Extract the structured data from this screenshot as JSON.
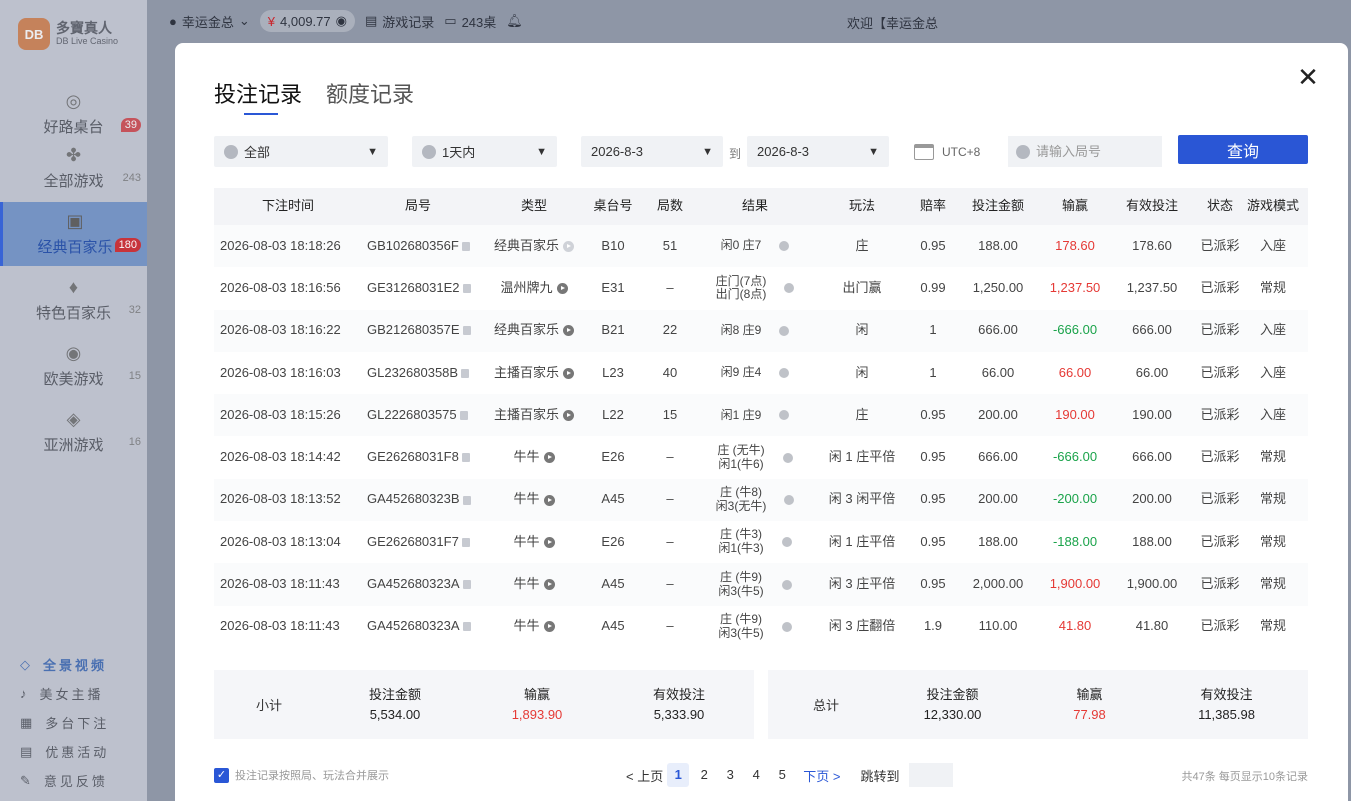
{
  "sidebar": {
    "logo_text": "多寶真人",
    "logo_sub": "DB Live Casino",
    "logo_box": "DB",
    "items": [
      {
        "label": "好路桌台",
        "count": "39",
        "icon": "roulette-icon"
      },
      {
        "label": "全部游戏",
        "count": "243",
        "icon": "clover-icon"
      },
      {
        "label": "经典百家乐",
        "count": "180",
        "icon": "cards-icon"
      },
      {
        "label": "特色百家乐",
        "count": "32",
        "icon": "card-icon"
      },
      {
        "label": "欧美游戏",
        "count": "15",
        "icon": "chip-icon"
      },
      {
        "label": "亚洲游戏",
        "count": "16",
        "icon": "dice-icon"
      }
    ],
    "bottom_links": [
      "全景视频",
      "美女主播",
      "多台下注",
      "优惠活动",
      "意见反馈"
    ]
  },
  "topbar": {
    "user": "幸运金总",
    "balance": "4,009.77",
    "records": "游戏记录",
    "tables": "243桌",
    "welcome": "欢迎【幸运金总"
  },
  "modal": {
    "tabs": [
      "投注记录",
      "额度记录"
    ],
    "filters": {
      "game": "全部",
      "period": "1天内",
      "date_from": "2026-8-3",
      "to_label": "到",
      "date_to": "2026-8-3",
      "timezone": "UTC+8",
      "search_placeholder": "请输入局号",
      "query_button": "查询"
    },
    "columns": [
      "下注时间",
      "局号",
      "类型",
      "桌台号",
      "局数",
      "结果",
      "玩法",
      "赔率",
      "投注金额",
      "输赢",
      "有效投注",
      "状态",
      "游戏模式"
    ],
    "rows": [
      {
        "time": "2026-08-03 18:18:26",
        "id": "GB102680356F",
        "type": "经典百家乐",
        "table": "B10",
        "round": "51",
        "result": "闲0 庄7",
        "play": "庄",
        "odds": "0.95",
        "bet": "188.00",
        "winloss": "178.60",
        "wl_status": "win",
        "valid": "178.60",
        "status": "已派彩",
        "mode": "入座"
      },
      {
        "time": "2026-08-03 18:16:56",
        "id": "GE31268031E2",
        "type": "温州牌九",
        "table": "E31",
        "round": "–",
        "result": "庄门(7点)\n出门(8点)",
        "play": "出门赢",
        "odds": "0.99",
        "bet": "1,250.00",
        "winloss": "1,237.50",
        "wl_status": "win",
        "valid": "1,237.50",
        "status": "已派彩",
        "mode": "常规"
      },
      {
        "time": "2026-08-03 18:16:22",
        "id": "GB212680357E",
        "type": "经典百家乐",
        "table": "B21",
        "round": "22",
        "result": "闲8 庄9",
        "play": "闲",
        "odds": "1",
        "bet": "666.00",
        "winloss": "-666.00",
        "wl_status": "lose",
        "valid": "666.00",
        "status": "已派彩",
        "mode": "入座"
      },
      {
        "time": "2026-08-03 18:16:03",
        "id": "GL232680358B",
        "type": "主播百家乐",
        "table": "L23",
        "round": "40",
        "result": "闲9 庄4",
        "play": "闲",
        "odds": "1",
        "bet": "66.00",
        "winloss": "66.00",
        "wl_status": "win",
        "valid": "66.00",
        "status": "已派彩",
        "mode": "入座"
      },
      {
        "time": "2026-08-03 18:15:26",
        "id": "GL2226803575",
        "type": "主播百家乐",
        "table": "L22",
        "round": "15",
        "result": "闲1 庄9",
        "play": "庄",
        "odds": "0.95",
        "bet": "200.00",
        "winloss": "190.00",
        "wl_status": "win",
        "valid": "190.00",
        "status": "已派彩",
        "mode": "入座"
      },
      {
        "time": "2026-08-03 18:14:42",
        "id": "GE26268031F8",
        "type": "牛牛",
        "table": "E26",
        "round": "–",
        "result": "庄 (无牛)\n闲1(牛6)",
        "play": "闲 1 庄平倍",
        "odds": "0.95",
        "bet": "666.00",
        "winloss": "-666.00",
        "wl_status": "lose",
        "valid": "666.00",
        "status": "已派彩",
        "mode": "常规"
      },
      {
        "time": "2026-08-03 18:13:52",
        "id": "GA452680323B",
        "type": "牛牛",
        "table": "A45",
        "round": "–",
        "result": "庄 (牛8)\n闲3(无牛)",
        "play": "闲 3 闲平倍",
        "odds": "0.95",
        "bet": "200.00",
        "winloss": "-200.00",
        "wl_status": "lose",
        "valid": "200.00",
        "status": "已派彩",
        "mode": "常规"
      },
      {
        "time": "2026-08-03 18:13:04",
        "id": "GE26268031F7",
        "type": "牛牛",
        "table": "E26",
        "round": "–",
        "result": "庄 (牛3)\n闲1(牛3)",
        "play": "闲 1 庄平倍",
        "odds": "0.95",
        "bet": "188.00",
        "winloss": "-188.00",
        "wl_status": "lose",
        "valid": "188.00",
        "status": "已派彩",
        "mode": "常规"
      },
      {
        "time": "2026-08-03 18:11:43",
        "id": "GA452680323A",
        "type": "牛牛",
        "table": "A45",
        "round": "–",
        "result": "庄 (牛9)\n闲3(牛5)",
        "play": "闲 3 庄平倍",
        "odds": "0.95",
        "bet": "2,000.00",
        "winloss": "1,900.00",
        "wl_status": "win",
        "valid": "1,900.00",
        "status": "已派彩",
        "mode": "常规"
      },
      {
        "time": "2026-08-03 18:11:43",
        "id": "GA452680323A",
        "type": "牛牛",
        "table": "A45",
        "round": "–",
        "result": "庄 (牛9)\n闲3(牛5)",
        "play": "闲 3 庄翻倍",
        "odds": "1.9",
        "bet": "110.00",
        "winloss": "41.80",
        "wl_status": "win",
        "valid": "41.80",
        "status": "已派彩",
        "mode": "常规"
      }
    ],
    "subtotal": {
      "label": "小计",
      "bet_label": "投注金额",
      "bet": "5,534.00",
      "wl_label": "输赢",
      "wl": "1,893.90",
      "valid_label": "有效投注",
      "valid": "5,333.90"
    },
    "total": {
      "label": "总计",
      "bet_label": "投注金额",
      "bet": "12,330.00",
      "wl_label": "输赢",
      "wl": "77.98",
      "valid_label": "有效投注",
      "valid": "11,385.98"
    },
    "footer": {
      "merge_checkbox": "投注记录按照局、玩法合并展示",
      "prev": "< 上页",
      "pages": [
        "1",
        "2",
        "3",
        "4",
        "5"
      ],
      "current_page": "1",
      "next": "下页 >",
      "jump": "跳转到",
      "totals": "共47条   每页显示10条记录"
    }
  },
  "colors": {
    "accent": "#2a57d6",
    "win": "#e53935",
    "lose": "#1aa34a"
  }
}
